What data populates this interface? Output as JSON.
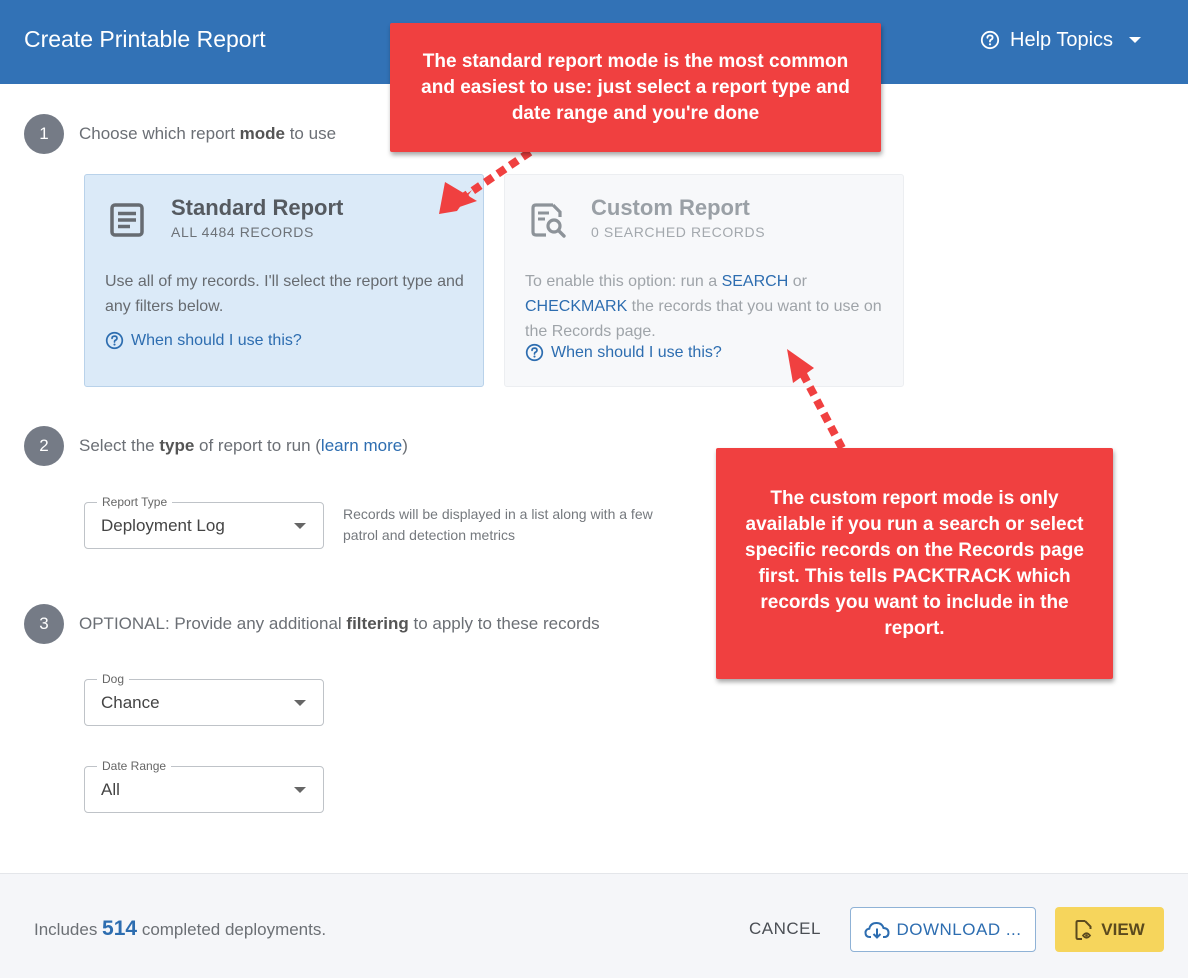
{
  "header": {
    "title": "Create Printable Report",
    "help_label": "Help Topics"
  },
  "steps": [
    {
      "number": "1",
      "pre": "Choose which report ",
      "bold": "mode",
      "post": " to use"
    },
    {
      "number": "2",
      "pre": "Select the ",
      "bold": "type",
      "post": " of report to run (",
      "link": "learn more",
      "after": ")"
    },
    {
      "number": "3",
      "pre": "OPTIONAL: Provide any additional ",
      "bold": "filtering",
      "post": " to apply to these records"
    }
  ],
  "standard_card": {
    "title": "Standard Report",
    "subtitle": "ALL 4484 RECORDS",
    "description": "Use all of my records. I'll select the report type and any filters below.",
    "help_link": "When should I use this?"
  },
  "custom_card": {
    "title": "Custom Report",
    "subtitle": "0 SEARCHED RECORDS",
    "desc_pre": "To enable this option: run a ",
    "desc_link1": "SEARCH",
    "desc_mid": " or ",
    "desc_link2": "CHECKMARK",
    "desc_post": " the records that you want to use on the Records page.",
    "help_link": "When should I use this?"
  },
  "report_type": {
    "label": "Report Type",
    "value": "Deployment Log",
    "hint": "Records will be displayed in a list along with a few patrol and detection metrics"
  },
  "dog_filter": {
    "label": "Dog",
    "value": "Chance"
  },
  "date_filter": {
    "label": "Date Range",
    "value": "All"
  },
  "footer": {
    "includes_pre": "Includes ",
    "count": "514",
    "includes_post": " completed deployments.",
    "cancel_label": "CANCEL",
    "download_label": "DOWNLOAD ...",
    "view_label": "VIEW"
  },
  "callouts": {
    "standard": "The standard report mode is the most common and easiest to use: just select a report type and date range and you're done",
    "custom": "The custom report mode is only available if you run a search or select specific records on the Records page first. This tells PACKTRACK which records you want to include in the report."
  },
  "colors": {
    "header": "#3272b6",
    "accent": "#2d6db0",
    "callout": "#f04040",
    "standard_card_bg": "#dbeaf8",
    "view_button": "#f6d55c"
  },
  "icons": [
    "help-circle-icon",
    "chevron-down-icon",
    "document-lines-icon",
    "document-search-icon",
    "cloud-download-icon",
    "document-eye-icon"
  ]
}
